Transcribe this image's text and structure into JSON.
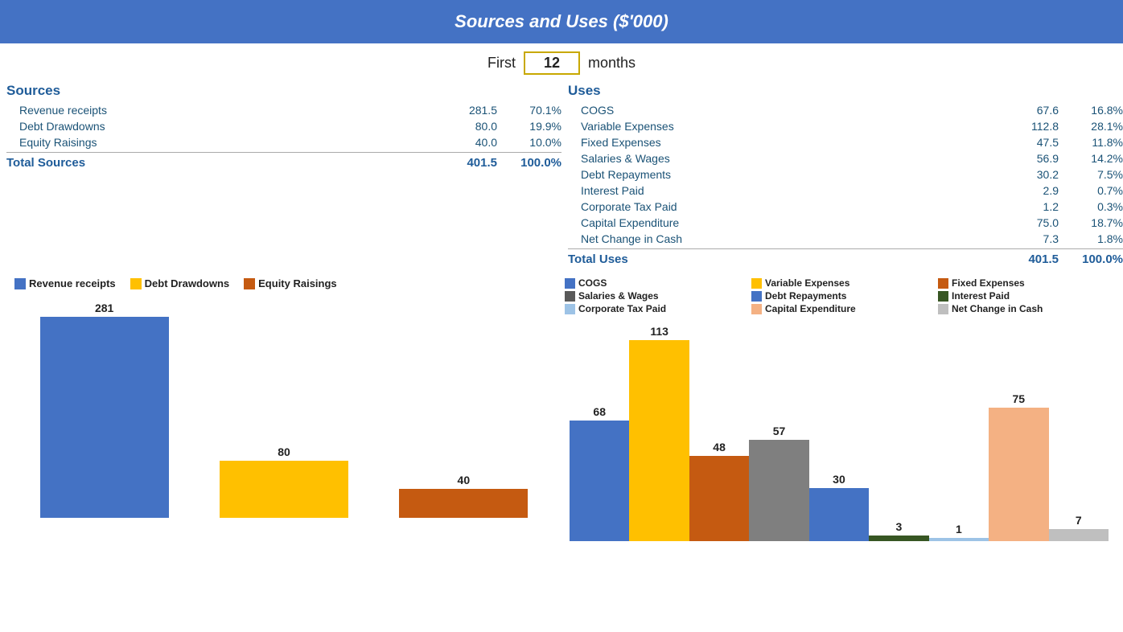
{
  "header": {
    "title": "Sources and Uses ($'000)"
  },
  "months_row": {
    "first_label": "First",
    "value": "12",
    "months_label": "months"
  },
  "sources": {
    "title": "Sources",
    "items": [
      {
        "label": "Revenue receipts",
        "value": "281.5",
        "pct": "70.1%"
      },
      {
        "label": "Debt Drawdowns",
        "value": "80.0",
        "pct": "19.9%"
      },
      {
        "label": "Equity Raisings",
        "value": "40.0",
        "pct": "10.0%"
      }
    ],
    "total_label": "Total Sources",
    "total_value": "401.5",
    "total_pct": "100.0%"
  },
  "uses": {
    "title": "Uses",
    "items": [
      {
        "label": "COGS",
        "value": "67.6",
        "pct": "16.8%"
      },
      {
        "label": "Variable Expenses",
        "value": "112.8",
        "pct": "28.1%"
      },
      {
        "label": "Fixed Expenses",
        "value": "47.5",
        "pct": "11.8%"
      },
      {
        "label": "Salaries & Wages",
        "value": "56.9",
        "pct": "14.2%"
      },
      {
        "label": "Debt Repayments",
        "value": "30.2",
        "pct": "7.5%"
      },
      {
        "label": "Interest Paid",
        "value": "2.9",
        "pct": "0.7%"
      },
      {
        "label": "Corporate Tax Paid",
        "value": "1.2",
        "pct": "0.3%"
      },
      {
        "label": "Capital Expenditure",
        "value": "75.0",
        "pct": "18.7%"
      },
      {
        "label": "Net Change in Cash",
        "value": "7.3",
        "pct": "1.8%"
      }
    ],
    "total_label": "Total Uses",
    "total_value": "401.5",
    "total_pct": "100.0%"
  },
  "left_chart": {
    "legend": [
      {
        "name": "Revenue receipts",
        "color": "#4472C4"
      },
      {
        "name": "Debt Drawdowns",
        "color": "#FFC000"
      },
      {
        "name": "Equity Raisings",
        "color": "#C55A11"
      }
    ],
    "bars": [
      {
        "label": "281",
        "value": 281,
        "color": "#4472C4",
        "max": 281
      },
      {
        "label": "80",
        "value": 80,
        "color": "#FFC000",
        "max": 281
      },
      {
        "label": "40",
        "value": 40,
        "color": "#C55A11",
        "max": 281
      }
    ]
  },
  "right_chart": {
    "legend": [
      {
        "name": "COGS",
        "color": "#4472C4"
      },
      {
        "name": "Variable Expenses",
        "color": "#FFC000"
      },
      {
        "name": "Fixed Expenses",
        "color": "#C55A11"
      },
      {
        "name": "Salaries & Wages",
        "color": "#595959"
      },
      {
        "name": "Debt Repayments",
        "color": "#4472C4"
      },
      {
        "name": "Interest Paid",
        "color": "#375623"
      },
      {
        "name": "Corporate Tax Paid",
        "color": "#9DC3E6"
      },
      {
        "name": "Capital Expenditure",
        "color": "#F4B183"
      },
      {
        "name": "Net Change in Cash",
        "color": "#BFBFBF"
      }
    ],
    "bars": [
      {
        "label": "68",
        "value": 68,
        "color": "#4472C4"
      },
      {
        "label": "113",
        "value": 113,
        "color": "#FFC000"
      },
      {
        "label": "48",
        "value": 48,
        "color": "#C55A11"
      },
      {
        "label": "57",
        "value": 57,
        "color": "#7F7F7F"
      },
      {
        "label": "30",
        "value": 30,
        "color": "#4472C4"
      },
      {
        "label": "3",
        "value": 3,
        "color": "#375623"
      },
      {
        "label": "1",
        "value": 1,
        "color": "#9DC3E6"
      },
      {
        "label": "75",
        "value": 75,
        "color": "#F4B183"
      },
      {
        "label": "7",
        "value": 7,
        "color": "#BFBFBF"
      }
    ],
    "max": 113
  }
}
